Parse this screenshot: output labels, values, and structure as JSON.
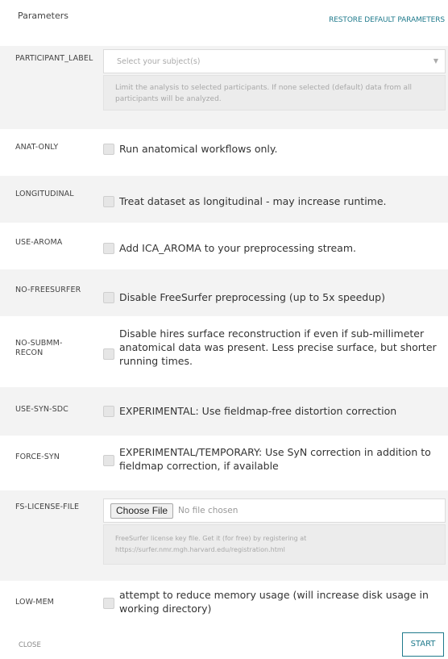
{
  "header": {
    "title": "Parameters",
    "restore_label": "RESTORE DEFAULT PARAMETERS"
  },
  "participant_label": {
    "label": "PARTICIPANT_LABEL",
    "placeholder": "Select your subject(s)",
    "help": "Limit the analysis to selected participants. If none selected (default) data from all participants will be analyzed."
  },
  "anat_only": {
    "label": "ANAT-ONLY",
    "text": "Run anatomical workflows only.",
    "checked": false
  },
  "longitudinal": {
    "label": "LONGITUDINAL",
    "text": "Treat dataset as longitudinal - may increase runtime.",
    "checked": false
  },
  "use_aroma": {
    "label": "USE-AROMA",
    "text": "Add ICA_AROMA to your preprocessing stream.",
    "checked": false
  },
  "no_freesurfer": {
    "label": "NO-FREESURFER",
    "text": "Disable FreeSurfer preprocessing (up to 5x speedup)",
    "checked": false
  },
  "no_submm_recon": {
    "label_line1": "NO-SUBMM-",
    "label_line2": "RECON",
    "text_line1": "Disable hires surface reconstruction if even if sub-millimeter",
    "text_line2": "anatomical data was present. Less precise surface, but shorter",
    "text_line3": "running times.",
    "checked": false
  },
  "use_syn_sdc": {
    "label": "USE-SYN-SDC",
    "text": "EXPERIMENTAL: Use fieldmap-free distortion correction",
    "checked": false
  },
  "force_syn": {
    "label": "FORCE-SYN",
    "text_line1": "EXPERIMENTAL/TEMPORARY: Use SyN correction in addition to",
    "text_line2": "fieldmap correction, if available",
    "checked": false
  },
  "fs_license_file": {
    "label": "FS-LICENSE-FILE",
    "button_label": "Choose File",
    "no_file_text": "No file chosen",
    "help_line1": "FreeSurfer license key file. Get it (for free) by registering at",
    "help_line2": "https://surfer.nmr.mgh.harvard.edu/registration.html"
  },
  "low_mem": {
    "label": "LOW-MEM",
    "text_line1": "attempt to reduce memory usage (will increase disk usage in",
    "text_line2": "working directory)",
    "checked": false
  },
  "footer": {
    "close_label": "CLOSE",
    "start_label": "START"
  },
  "colors": {
    "accent": "#1f7a8c",
    "row_shade": "#f3f3f3",
    "help_bg": "#ececec"
  }
}
